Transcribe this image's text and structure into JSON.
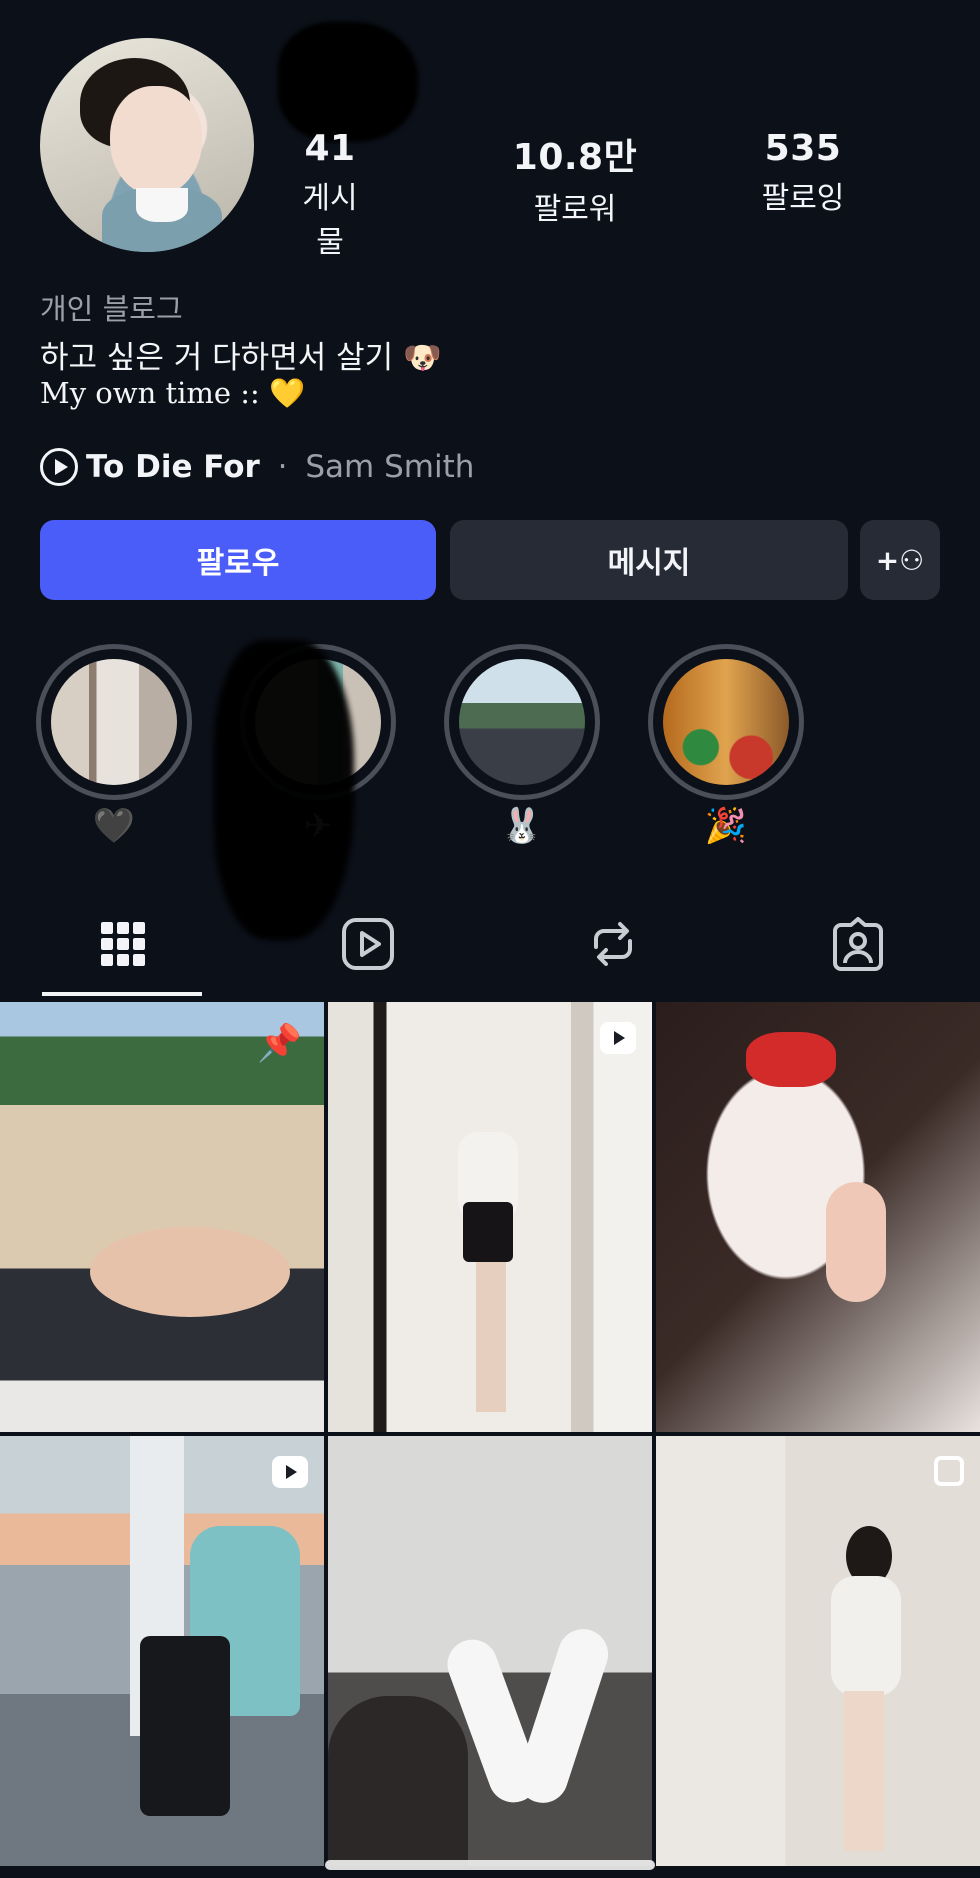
{
  "profile": {
    "stats": [
      {
        "count": "41",
        "label": "게시물"
      },
      {
        "count": "10.8만",
        "label": "팔로워"
      },
      {
        "count": "535",
        "label": "팔로잉"
      }
    ],
    "category": "개인 블로그",
    "bio_line1": "하고 싶은 거 다하면서 살기 🐶",
    "bio_line2": "My own time :: 💛",
    "music": {
      "song": "To Die For",
      "separator": " · ",
      "artist": "Sam Smith"
    }
  },
  "actions": {
    "follow_label": "팔로우",
    "message_label": "메시지",
    "add_user_label": "+⚇"
  },
  "highlights": [
    {
      "label": "🖤"
    },
    {
      "label": "✈"
    },
    {
      "label": "🐰"
    },
    {
      "label": "🎉"
    }
  ],
  "tabs": [
    {
      "icon": "grid-icon",
      "active": true
    },
    {
      "icon": "reels-icon",
      "active": false
    },
    {
      "icon": "repost-icon",
      "active": false
    },
    {
      "icon": "tagged-icon",
      "active": false
    }
  ],
  "posts": [
    {
      "type": "pinned",
      "badge_icon": "pin-icon"
    },
    {
      "type": "reel",
      "badge_icon": "reel-icon"
    },
    {
      "type": "photo",
      "badge_icon": ""
    },
    {
      "type": "reel",
      "badge_icon": "reel-icon"
    },
    {
      "type": "photo",
      "badge_icon": ""
    },
    {
      "type": "carousel",
      "badge_icon": "carousel-icon"
    }
  ],
  "colors": {
    "background": "#0c1019",
    "follow_button": "#4a5df9",
    "secondary_button": "#262b35",
    "muted_text": "#9aa0aa"
  }
}
